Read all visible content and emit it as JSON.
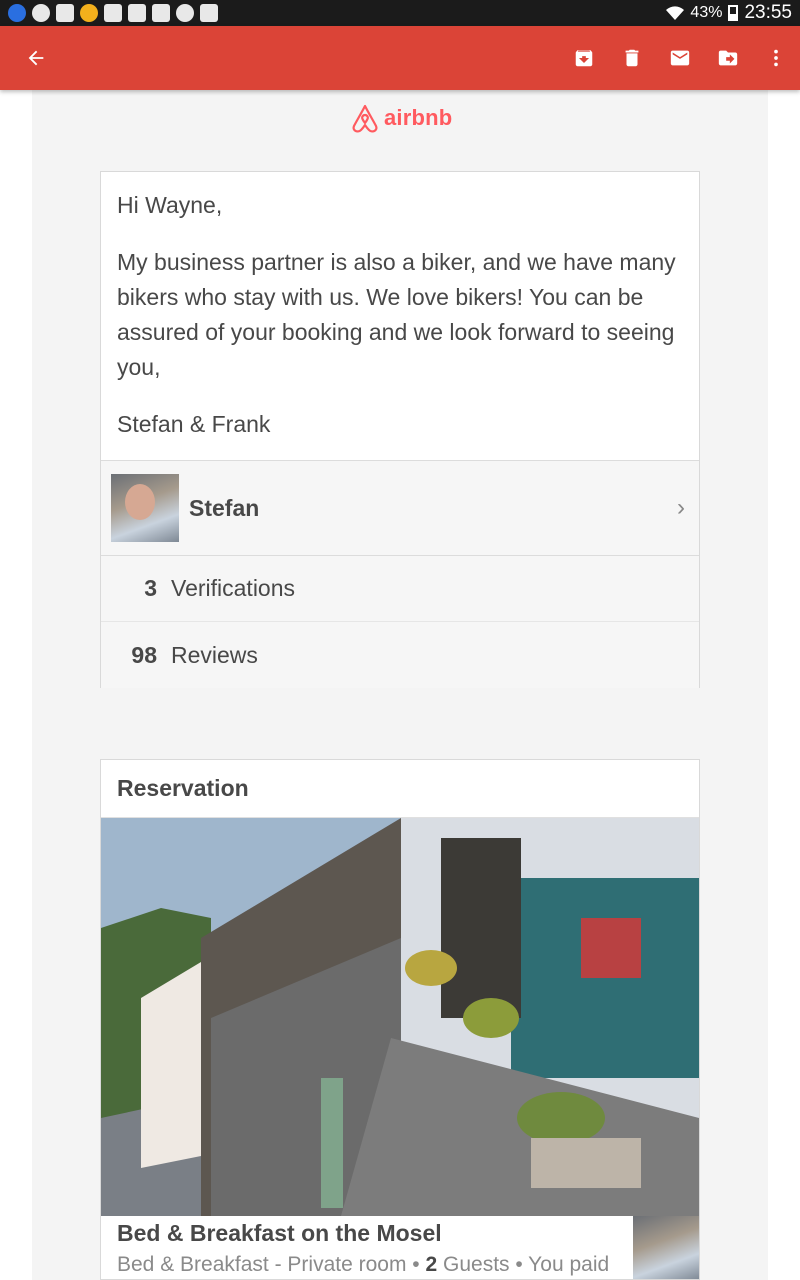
{
  "status_bar": {
    "battery": "43%",
    "time": "23:55"
  },
  "app_bar": {
    "back_icon": "arrow-back-icon",
    "actions": [
      "archive-icon",
      "delete-icon",
      "mail-icon",
      "move-to-icon",
      "more-vert-icon"
    ]
  },
  "email": {
    "brand": "airbnb",
    "brand_color": "#ff5a5f",
    "message": {
      "greeting": "Hi Wayne,",
      "body": "My business partner is also a biker, and we have many bikers who stay with us. We love bikers! You can be assured of your booking and we look forward to seeing you,",
      "signature": "Stefan & Frank"
    },
    "host": {
      "name": "Stefan",
      "verifications_count": "3",
      "verifications_label": "Verifications",
      "reviews_count": "98",
      "reviews_label": "Reviews"
    },
    "reservation": {
      "heading": "Reservation",
      "listing_title": "Bed & Breakfast on the Mosel",
      "listing_type": "Bed & Breakfast - Private room •",
      "guests_count": "2",
      "guests_suffix": "Guests • You paid"
    }
  },
  "colors": {
    "app_bar": "#db4437",
    "status_bar": "#1b1b1b"
  }
}
